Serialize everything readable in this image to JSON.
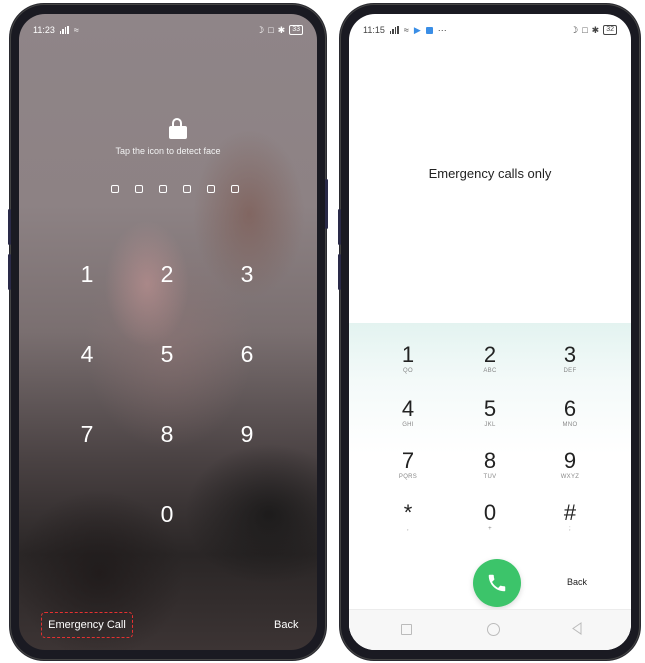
{
  "left_phone": {
    "status": {
      "time": "11:23",
      "battery": "33"
    },
    "face_hint": "Tap the icon to detect face",
    "pin_length": 6,
    "keys": [
      "1",
      "2",
      "3",
      "4",
      "5",
      "6",
      "7",
      "8",
      "9",
      "0"
    ],
    "emergency_call_label": "Emergency Call",
    "back_label": "Back"
  },
  "right_phone": {
    "status": {
      "time": "11:15",
      "battery": "32"
    },
    "message": "Emergency calls only",
    "keys": [
      {
        "num": "1",
        "sub": "QO"
      },
      {
        "num": "2",
        "sub": "ABC"
      },
      {
        "num": "3",
        "sub": "DEF"
      },
      {
        "num": "4",
        "sub": "GHI"
      },
      {
        "num": "5",
        "sub": "JKL"
      },
      {
        "num": "6",
        "sub": "MNO"
      },
      {
        "num": "7",
        "sub": "PQRS"
      },
      {
        "num": "8",
        "sub": "TUV"
      },
      {
        "num": "9",
        "sub": "WXYZ"
      },
      {
        "num": "*",
        "sub": ","
      },
      {
        "num": "0",
        "sub": "+"
      },
      {
        "num": "#",
        "sub": ";"
      }
    ],
    "back_label": "Back",
    "colors": {
      "call_button": "#3cc46a"
    }
  }
}
